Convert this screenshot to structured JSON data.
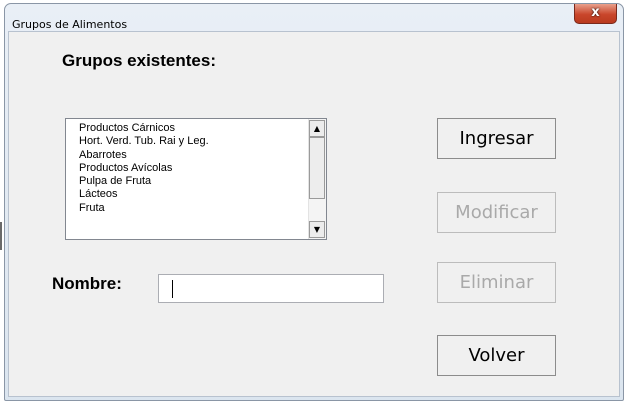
{
  "window": {
    "title": "Grupos de Alimentos",
    "close_label": "x"
  },
  "groups": {
    "heading": "Grupos existentes:",
    "items": [
      "Productos Cárnicos",
      "Hort. Verd. Tub. Rai y Leg.",
      "Abarrotes",
      "Productos Avícolas",
      "Pulpa de Fruta",
      "Lácteos",
      "Fruta"
    ]
  },
  "form": {
    "name_label": "Nombre:",
    "name_value": ""
  },
  "buttons": {
    "ingresar": {
      "label": "Ingresar",
      "enabled": true
    },
    "modificar": {
      "label": "Modificar",
      "enabled": false
    },
    "eliminar": {
      "label": "Eliminar",
      "enabled": false
    },
    "volver": {
      "label": "Volver",
      "enabled": true
    }
  },
  "icons": {
    "scroll_up": "scroll-up-arrow-icon",
    "scroll_down": "scroll-down-arrow-icon",
    "close": "close-icon"
  }
}
